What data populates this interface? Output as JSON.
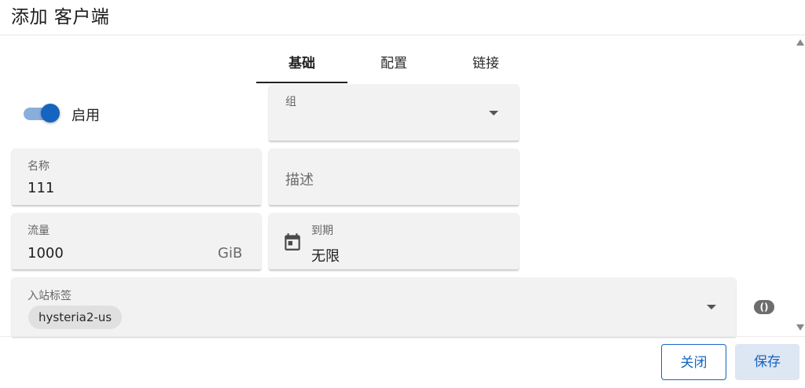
{
  "dialog": {
    "title": "添加 客户端"
  },
  "tabs": [
    {
      "label": "基础",
      "active": true
    },
    {
      "label": "配置",
      "active": false
    },
    {
      "label": "链接",
      "active": false
    }
  ],
  "enable": {
    "label": "启用",
    "checked": true
  },
  "group": {
    "label": "组",
    "value": ""
  },
  "name": {
    "label": "名称",
    "value": "111"
  },
  "description": {
    "placeholder": "描述"
  },
  "traffic": {
    "label": "流量",
    "value": "1000",
    "unit": "GiB"
  },
  "expiry": {
    "label": "到期",
    "value": "无限",
    "icon": "calendar-icon"
  },
  "inbound_tags": {
    "label": "入站标签",
    "chips": [
      "hysteria2-us"
    ]
  },
  "json_toggle": {
    "label": "()"
  },
  "footer": {
    "close_label": "关闭",
    "save_label": "保存"
  },
  "colors": {
    "accent": "#1565c0",
    "switch_track": "#8aaedb",
    "field_bg": "#f2f2f2",
    "save_bg": "#dde6f3"
  }
}
